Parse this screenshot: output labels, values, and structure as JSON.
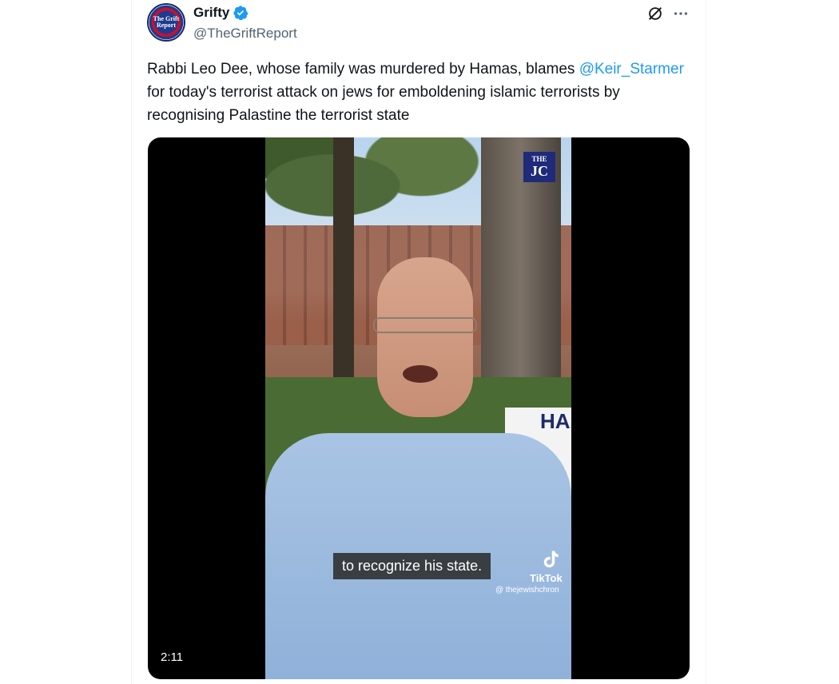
{
  "tweet": {
    "author": {
      "display_name": "Grifty",
      "handle": "@TheGriftReport",
      "avatar_text": "The Grift Report",
      "verified": true
    },
    "text_before": "Rabbi Leo Dee, whose family was murdered by Hamas, blames ",
    "mention": "@Keir_Starmer",
    "text_after": " for today's terrorist attack on jews for emboldening islamic terrorists by recognising Palastine the terrorist state",
    "actions": {
      "grok_icon": "grok-icon",
      "more_icon": "more-icon"
    },
    "media": {
      "type": "video",
      "duration": "2:11",
      "caption": "to recognize his state.",
      "watermark_logo": {
        "top": "THE",
        "bottom": "JC"
      },
      "tiktok_label": "TikTok",
      "tiktok_handle": "@ thejewishchron",
      "sign_text": "HA"
    }
  },
  "colors": {
    "accent": "#1d9bf0",
    "text": "#0f1419",
    "secondary_text": "#536471",
    "verified_badge": "#1d9bf0"
  }
}
